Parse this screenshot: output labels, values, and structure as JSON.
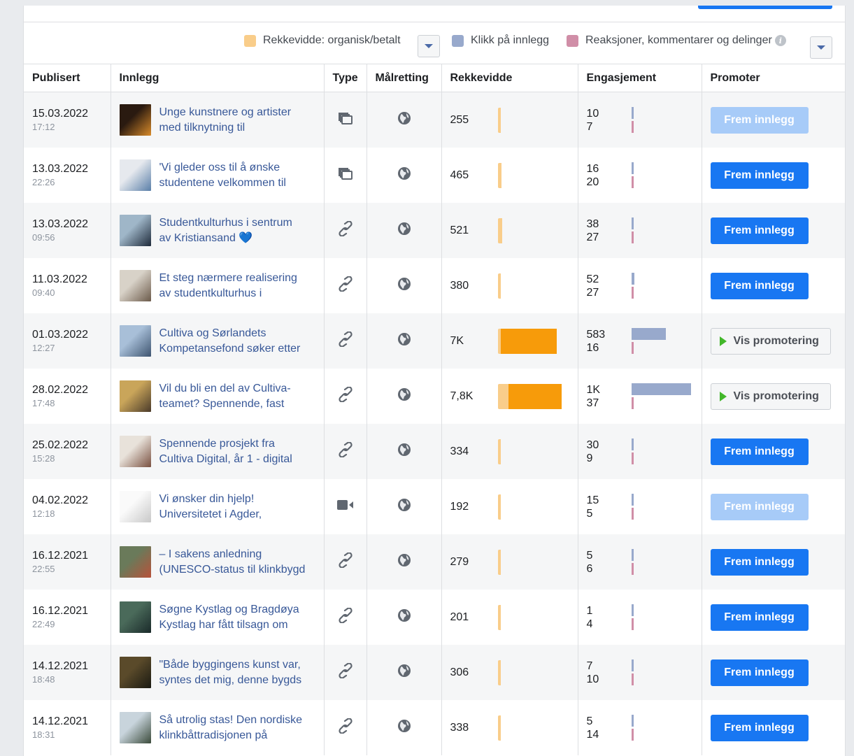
{
  "legend": {
    "reach_label": "Rekkevidde: organisk/betalt",
    "clicks_label": "Klikk på innlegg",
    "reactions_label": "Reaksjoner, kommentarer og delinger",
    "info_glyph": "i",
    "colors": {
      "reach": "#f9cd8a",
      "reach_paid": "#f79b0a",
      "clicks": "#98a9cc",
      "reactions": "#d08ea7"
    }
  },
  "headers": [
    "Publisert",
    "Innlegg",
    "Type",
    "Målretting",
    "Rekkevidde",
    "Engasjement",
    "Promoter"
  ],
  "max_reach": 7800,
  "max_engagement": 1000,
  "rows": [
    {
      "date": "15.03.2022",
      "time": "17:12",
      "line1": "Unge kunstnere og artister",
      "line2": "med tilknytning til",
      "type": "album-icon",
      "reach": "255",
      "reach_organic": 255,
      "reach_paid": 0,
      "clicks": "10",
      "clicks_v": 10,
      "reactions": "7",
      "reactions_v": 7,
      "action": "Frem innlegg",
      "action_type": "boost-disabled",
      "thumb": [
        "#2a1a10",
        "#d98b2a"
      ]
    },
    {
      "date": "13.03.2022",
      "time": "22:26",
      "line1": "'Vi gleder oss til å ønske",
      "line2": "studentene velkommen til",
      "type": "album-icon",
      "reach": "465",
      "reach_organic": 465,
      "reach_paid": 0,
      "clicks": "16",
      "clicks_v": 16,
      "reactions": "20",
      "reactions_v": 20,
      "action": "Frem innlegg",
      "action_type": "boost",
      "thumb": [
        "#e6e9ee",
        "#5a7fa8"
      ]
    },
    {
      "date": "13.03.2022",
      "time": "09:56",
      "line1": "Studentkulturhus i sentrum",
      "line2": "av Kristiansand 💙",
      "type": "link-icon",
      "reach": "521",
      "reach_organic": 521,
      "reach_paid": 0,
      "clicks": "38",
      "clicks_v": 38,
      "reactions": "27",
      "reactions_v": 27,
      "action": "Frem innlegg",
      "action_type": "boost",
      "thumb": [
        "#9fb6c8",
        "#1e2a3a"
      ]
    },
    {
      "date": "11.03.2022",
      "time": "09:40",
      "line1": "Et steg nærmere realisering",
      "line2": "av studentkulturhus i",
      "type": "link-icon",
      "reach": "380",
      "reach_organic": 380,
      "reach_paid": 0,
      "clicks": "52",
      "clicks_v": 52,
      "reactions": "27",
      "reactions_v": 27,
      "action": "Frem innlegg",
      "action_type": "boost",
      "thumb": [
        "#d8d2c8",
        "#6b5a4a"
      ]
    },
    {
      "date": "01.03.2022",
      "time": "12:27",
      "line1": "Cultiva og Sørlandets",
      "line2": "Kompetansefond søker etter",
      "type": "link-icon",
      "reach": "7K",
      "reach_organic": 200,
      "reach_paid": 6800,
      "clicks": "583",
      "clicks_v": 583,
      "reactions": "16",
      "reactions_v": 16,
      "action": "Vis promotering",
      "action_type": "view",
      "thumb": [
        "#a8bfd8",
        "#3e5470"
      ]
    },
    {
      "date": "28.02.2022",
      "time": "17:48",
      "line1": "Vil du bli en del av Cultiva-",
      "line2": "teamet? Spennende, fast",
      "type": "link-icon",
      "reach": "7,8K",
      "reach_organic": 1300,
      "reach_paid": 6500,
      "clicks": "1K",
      "clicks_v": 1000,
      "reactions": "37",
      "reactions_v": 37,
      "action": "Vis promotering",
      "action_type": "view",
      "thumb": [
        "#c9a55a",
        "#4a3a2a"
      ]
    },
    {
      "date": "25.02.2022",
      "time": "15:28",
      "line1": "Spennende prosjekt fra",
      "line2": "Cultiva Digital, år 1 - digital",
      "type": "link-icon",
      "reach": "334",
      "reach_organic": 334,
      "reach_paid": 0,
      "clicks": "30",
      "clicks_v": 30,
      "reactions": "9",
      "reactions_v": 9,
      "action": "Frem innlegg",
      "action_type": "boost",
      "thumb": [
        "#e8e2da",
        "#7a5040"
      ]
    },
    {
      "date": "04.02.2022",
      "time": "12:18",
      "line1": "Vi ønsker din hjelp!",
      "line2": "Universitetet i Agder,",
      "type": "video-icon",
      "reach": "192",
      "reach_organic": 192,
      "reach_paid": 0,
      "clicks": "15",
      "clicks_v": 15,
      "reactions": "5",
      "reactions_v": 5,
      "action": "Frem innlegg",
      "action_type": "boost-disabled",
      "thumb": [
        "#fafafa",
        "#c8c8c8"
      ]
    },
    {
      "date": "16.12.2021",
      "time": "22:55",
      "line1": "– I sakens anledning",
      "line2": "(UNESCO-status til klinkbygd",
      "type": "link-icon",
      "reach": "279",
      "reach_organic": 279,
      "reach_paid": 0,
      "clicks": "5",
      "clicks_v": 5,
      "reactions": "6",
      "reactions_v": 6,
      "action": "Frem innlegg",
      "action_type": "boost",
      "thumb": [
        "#6a7a5a",
        "#b8523a"
      ]
    },
    {
      "date": "16.12.2021",
      "time": "22:49",
      "line1": "Søgne Kystlag og Bragdøya",
      "line2": "Kystlag har fått tilsagn om",
      "type": "link-icon",
      "reach": "201",
      "reach_organic": 201,
      "reach_paid": 0,
      "clicks": "1",
      "clicks_v": 1,
      "reactions": "4",
      "reactions_v": 4,
      "action": "Frem innlegg",
      "action_type": "boost",
      "thumb": [
        "#4a6a5a",
        "#1a2a2a"
      ]
    },
    {
      "date": "14.12.2021",
      "time": "18:48",
      "line1": "\"Både byggingens kunst var,",
      "line2": "syntes det mig, denne bygds",
      "type": "link-icon",
      "reach": "306",
      "reach_organic": 306,
      "reach_paid": 0,
      "clicks": "7",
      "clicks_v": 7,
      "reactions": "10",
      "reactions_v": 10,
      "action": "Frem innlegg",
      "action_type": "boost",
      "thumb": [
        "#5a4a2a",
        "#1a1a12"
      ]
    },
    {
      "date": "14.12.2021",
      "time": "18:31",
      "line1": "Så utrolig stas! Den nordiske",
      "line2": "klinkbåttradisjonen på",
      "type": "link-icon",
      "reach": "338",
      "reach_organic": 338,
      "reach_paid": 0,
      "clicks": "5",
      "clicks_v": 5,
      "reactions": "14",
      "reactions_v": 14,
      "action": "Frem innlegg",
      "action_type": "boost",
      "thumb": [
        "#c8d4dc",
        "#3a4a3a"
      ]
    }
  ]
}
